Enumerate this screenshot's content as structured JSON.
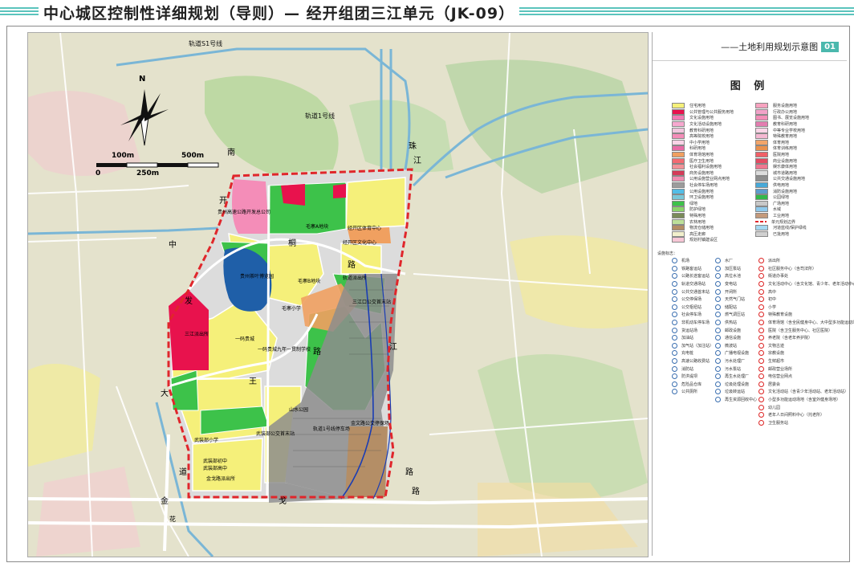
{
  "header": {
    "title": "中心城区控制性详细规划（导则）— 经开组团三江单元（JK-09）"
  },
  "map_title": {
    "text": "——土地利用规划示意图",
    "badge": "01"
  },
  "legend": {
    "heading": "图 例",
    "land_use_left": [
      {
        "label": "住宅用地",
        "color": "#f5f07a"
      },
      {
        "label": "公共管理与公共服务用地",
        "color": "#e8124d"
      },
      {
        "label": "文化设施用地",
        "color": "#f37ab4"
      },
      {
        "label": "文化活动设施用地",
        "color": "#f7a8cf"
      },
      {
        "label": "教育科研用地",
        "color": "#f2c6de"
      },
      {
        "label": "高等院校用地",
        "color": "#f48db8"
      },
      {
        "label": "中小学用地",
        "color": "#f9d3e6"
      },
      {
        "label": "科研用地",
        "color": "#e86aa5"
      },
      {
        "label": "体育场馆用地",
        "color": "#f0a060"
      },
      {
        "label": "医疗卫生用地",
        "color": "#f36b72"
      },
      {
        "label": "社会福利设施用地",
        "color": "#f29298"
      },
      {
        "label": "商务设施用地",
        "color": "#d43b58"
      },
      {
        "label": "公用设施营业网点用地",
        "color": "#f08cb0"
      },
      {
        "label": "社会停车场用地",
        "color": "#9c9c9c"
      },
      {
        "label": "公用设施用地",
        "color": "#53bde6"
      },
      {
        "label": "环卫设施用地",
        "color": "#7ac8d8"
      },
      {
        "label": "绿地",
        "color": "#3dc24a"
      },
      {
        "label": "防护绿地",
        "color": "#8bd36a"
      },
      {
        "label": "特殊用地",
        "color": "#7a8a5a"
      },
      {
        "label": "农林用地",
        "color": "#bde09a"
      },
      {
        "label": "物流仓储用地",
        "color": "#b48e66"
      },
      {
        "label": "高压走廊",
        "color": "#f2f0cc"
      },
      {
        "label": "规划村镇建设区",
        "color": "#f7c7d6"
      }
    ],
    "land_use_right": [
      {
        "label": "服务设施用地",
        "color": "#f7a3c0"
      },
      {
        "label": "行政办公用地",
        "color": "#f1a2c8"
      },
      {
        "label": "图书、展览设施用地",
        "color": "#f38eb8"
      },
      {
        "label": "教育科研用地",
        "color": "#e37db0"
      },
      {
        "label": "中等专业学校用地",
        "color": "#fbd5e7"
      },
      {
        "label": "特殊教育用地",
        "color": "#f5b8d2"
      },
      {
        "label": "体育用地",
        "color": "#f2a56a"
      },
      {
        "label": "体育训练用地",
        "color": "#e9914d"
      },
      {
        "label": "医院用地",
        "color": "#f06068"
      },
      {
        "label": "商业设施用地",
        "color": "#e34b62"
      },
      {
        "label": "娱乐康体用地",
        "color": "#ef7690"
      },
      {
        "label": "城市道路用地",
        "color": "#dcdcdc"
      },
      {
        "label": "公共交通设施用地",
        "color": "#8d8d8d"
      },
      {
        "label": "供电用地",
        "color": "#48a9d8"
      },
      {
        "label": "消防设施用地",
        "color": "#5d9ccc"
      },
      {
        "label": "公园绿地",
        "color": "#33b84a"
      },
      {
        "label": "广场用地",
        "color": "#c8c8c8"
      },
      {
        "label": "水域",
        "color": "#8fc9ec"
      },
      {
        "label": "工业用地",
        "color": "#c49a7c"
      },
      {
        "label": "单元规划边界",
        "color": "#ffffff"
      },
      {
        "label": "河道蓝线/保护绿线",
        "color": "#a5d7f0"
      },
      {
        "label": "已批用地",
        "color": "#d0d0d0"
      }
    ],
    "symbols_header": "设施标志：",
    "symbols_left": [
      "机场",
      "铁路客运站",
      "公路长途客运站",
      "轨道交通场站",
      "公共交通首末站",
      "公交停保场",
      "公交枢纽站",
      "社会停车场",
      "非机动车停车场",
      "货运站场",
      "加油站",
      "加气站（加注站）",
      "充电桩",
      "高速公路收费站",
      "消防站",
      "防洪堤坝",
      "危险品仓库",
      "公共厕所"
    ],
    "symbols_mid": [
      "水厂",
      "加压泵站",
      "高位水池",
      "变电站",
      "开闭所",
      "天然气门站",
      "储配站",
      "燃气调压站",
      "供热站",
      "邮政设施",
      "通信设施",
      "微波站",
      "广播电视设施",
      "污水处理厂",
      "污水泵站",
      "再生水处理厂",
      "垃圾处理设施",
      "垃圾转运站",
      "再生资源回收中心"
    ],
    "symbols_right": [
      "派出所",
      "社区服务中心（含司法所）",
      "街道办事处",
      "文化活动中心（含文化馆、青少年、老年活动中心）",
      "高中",
      "初中",
      "小学",
      "特殊教育设施",
      "体育场馆（含全民健身中心、大中型多功能运动场地）",
      "医院（含卫生服务中心、社区医院）",
      "养老院（含老年养护院）",
      "文物古迹",
      "宗教设施",
      "生鲜超市",
      "邮政营业场所",
      "电信营业网点",
      "居委会",
      "文化活动站（含青少年活动站、老年活动站）",
      "小型多功能运动场地（含室外健身场地）",
      "幼儿园",
      "老年人日间照料中心（托老所）",
      "卫生服务站"
    ]
  },
  "map": {
    "scale": {
      "t0": "0",
      "t100": "100m",
      "t250": "250m",
      "t500": "500m"
    },
    "compass": "N",
    "labels": {
      "rail51": "轨道S1号线",
      "rail1": "轨道1号线",
      "road_nan": "南",
      "road_kai": "开",
      "road_zhu": "珠",
      "road_jiang": "江",
      "road_zhong": "中",
      "road_tong": "桐",
      "road_lu": "路",
      "road_fa": "发",
      "road_sanjiang": "江",
      "road_wang": "王",
      "road_tu": "路",
      "road_da": "大",
      "road_dao": "道",
      "road_jin": "金",
      "road_ge": "戈",
      "road_lu2": "路",
      "road_lu3": "路",
      "road_shi": "花",
      "bus_station_city": "贵州高速公路开发总公司",
      "maozhai_a": "毛寨A地块",
      "sports_center": "经开区体育中心",
      "culture_center": "经开区文化中心",
      "guizhou_tea": "贵州茶叶博览园",
      "maozhai_b": "毛寨B地块",
      "police": "轨道派出所",
      "maozhai_school": "毛寨小学",
      "sanjiang_bus": "三江口公交首末站",
      "sanjiang_police": "三江派出所",
      "yimachang": "一码贵城",
      "nine_year": "一码贵城九年一贯制学校",
      "shanshui_park": "山水公园",
      "wuzhuang_school": "武装部小学",
      "wuzhuang_middle": "武装部初中",
      "wuzhuang_bus": "武装部公交首末站",
      "rail1_depot": "轨道1号线停车场",
      "jinwen_bus": "金文路公交停保场",
      "wuzhuang_high": "武装部高中",
      "jinge_police": "金戈路派出所"
    }
  },
  "colors": {
    "accent": "#4bb8ad",
    "boundary": "#e0262b",
    "residential": "#f5f07a",
    "green": "#3dc24a",
    "water": "#1f5fa8"
  }
}
